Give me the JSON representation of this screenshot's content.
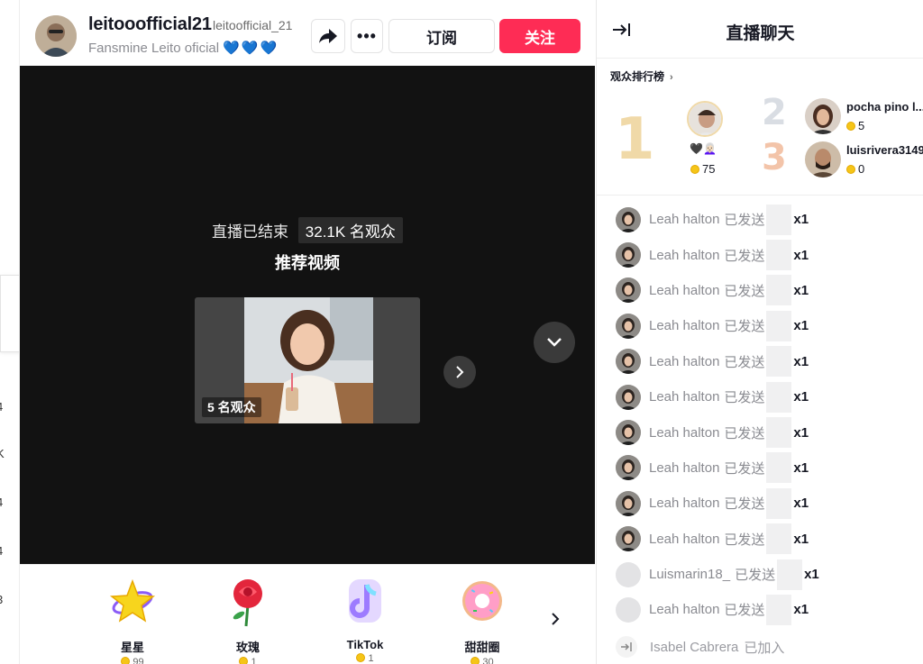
{
  "left_strip": {
    "fragments": [
      "4",
      "K",
      "4",
      "4",
      "3"
    ]
  },
  "header": {
    "host_name": "leitooofficial21",
    "host_handle": "leitoofficial_21",
    "host_subtitle": "Fansmine Leito oficial",
    "host_hearts": "💙💙💙",
    "subscribe_label": "订阅",
    "follow_label": "关注"
  },
  "video": {
    "ended_label": "直播已结束",
    "viewer_count": "32.1K 名观众",
    "recommended_title": "推荐视频",
    "card_viewers": "5 名观众"
  },
  "gifts": [
    {
      "name": "星星",
      "price": "99"
    },
    {
      "name": "玫瑰",
      "price": "1"
    },
    {
      "name": "TikTok",
      "price": "1"
    },
    {
      "name": "甜甜圈",
      "price": "30"
    }
  ],
  "chat_panel": {
    "title": "直播聊天",
    "ranking_label": "观众排行榜",
    "ranking": [
      {
        "rank": "1",
        "score": "75",
        "badges": "🖤👩🏻‍🦳"
      },
      {
        "rank": "2",
        "name": "pocha pino l...",
        "score": "5"
      },
      {
        "rank": "3",
        "name": "luisrivera3149",
        "score": "0"
      }
    ],
    "messages": [
      {
        "user": "Leah halton",
        "action": "已发送",
        "count": "x1"
      },
      {
        "user": "Leah halton",
        "action": "已发送",
        "count": "x1"
      },
      {
        "user": "Leah halton",
        "action": "已发送",
        "count": "x1"
      },
      {
        "user": "Leah halton",
        "action": "已发送",
        "count": "x1"
      },
      {
        "user": "Leah halton",
        "action": "已发送",
        "count": "x1"
      },
      {
        "user": "Leah halton",
        "action": "已发送",
        "count": "x1"
      },
      {
        "user": "Leah halton",
        "action": "已发送",
        "count": "x1"
      },
      {
        "user": "Leah halton",
        "action": "已发送",
        "count": "x1"
      },
      {
        "user": "Leah halton",
        "action": "已发送",
        "count": "x1"
      },
      {
        "user": "Leah halton",
        "action": "已发送",
        "count": "x1"
      },
      {
        "user": "Luismarin18_",
        "action": "已发送",
        "count": "x1"
      },
      {
        "user": "Leah halton",
        "action": "已发送",
        "count": "x1"
      }
    ],
    "join": {
      "user": "Isabel Cabrera",
      "action": "已加入"
    }
  },
  "colors": {
    "accent": "#fe2c55",
    "video_bg": "#121212"
  }
}
